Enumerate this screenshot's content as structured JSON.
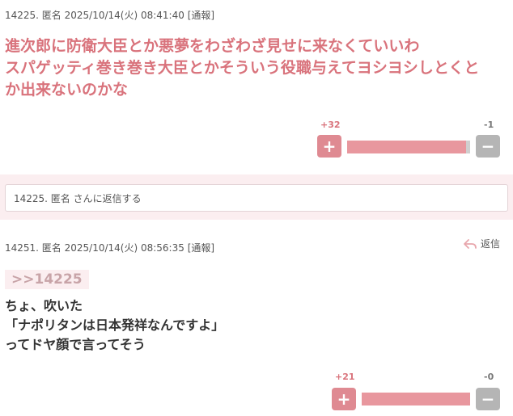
{
  "comments": [
    {
      "meta": "14225. 匿名 2025/10/14(火) 08:41:40",
      "report": "[通報]",
      "lines": [
        "進次郎に防衛大臣とか悪夢をわざわざ見せに来なくていいわ",
        "スパゲッティ巻き巻き大臣とかそういう役職与えてヨシヨシしとくと",
        "か出来ないのかな"
      ],
      "plus_count": "+32",
      "minus_count": "-1",
      "plus_label": "+",
      "minus_label": "−",
      "positive_ratio": 0.97
    },
    {
      "meta": "14251. 匿名 2025/10/14(火) 08:56:35",
      "report": "[通報]",
      "quote": ">>14225",
      "lines": [
        "ちょ、吹いた",
        "「ナポリタンは日本発祥なんですよ」",
        "ってドヤ顔で言ってそう"
      ],
      "plus_count": "+21",
      "minus_count": "-0",
      "plus_label": "+",
      "minus_label": "−",
      "positive_ratio": 1.0
    }
  ],
  "reply_box": {
    "placeholder": "14225. 匿名 さんに返信する"
  },
  "reply_link": {
    "label": "返信",
    "icon": "reply-arrow-icon"
  },
  "colors": {
    "accent": "#d9737c",
    "plus": "#df8a92",
    "minus": "#b5b5b5",
    "band": "#fbeef0"
  }
}
